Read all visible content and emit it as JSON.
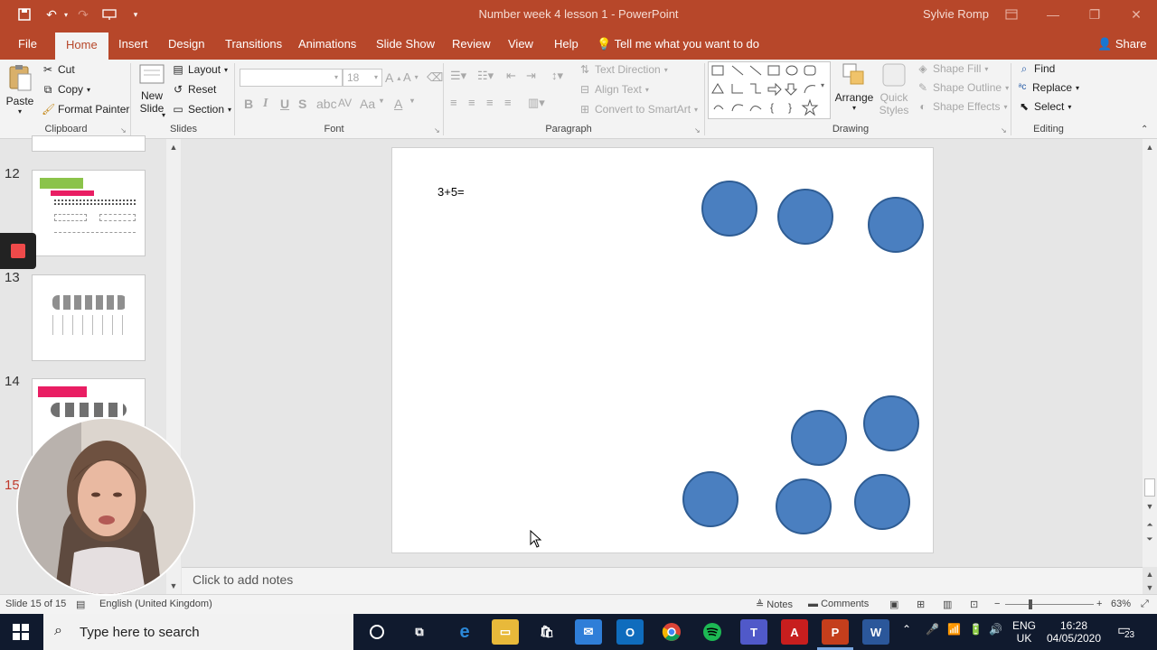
{
  "window": {
    "title": "Number week 4 lesson 1  -  PowerPoint",
    "user": "Sylvie Romp"
  },
  "tabs": [
    {
      "label": "File"
    },
    {
      "label": "Home"
    },
    {
      "label": "Insert"
    },
    {
      "label": "Design"
    },
    {
      "label": "Transitions"
    },
    {
      "label": "Animations"
    },
    {
      "label": "Slide Show"
    },
    {
      "label": "Review"
    },
    {
      "label": "View"
    },
    {
      "label": "Help"
    }
  ],
  "tell_me": "Tell me what you want to do",
  "share": "Share",
  "ribbon": {
    "clipboard": {
      "paste": "Paste",
      "cut": "Cut",
      "copy": "Copy",
      "format_painter": "Format Painter",
      "label": "Clipboard"
    },
    "slides": {
      "new_slide_1": "New",
      "new_slide_2": "Slide",
      "layout": "Layout",
      "reset": "Reset",
      "section": "Section",
      "label": "Slides"
    },
    "font": {
      "size": "18",
      "label": "Font",
      "bold": "B",
      "italic": "I",
      "underline": "U",
      "strike": "S",
      "case": "Aa"
    },
    "paragraph": {
      "text_direction": "Text Direction",
      "align_text": "Align Text",
      "convert_smartart": "Convert to SmartArt",
      "label": "Paragraph"
    },
    "drawing": {
      "arrange": "Arrange",
      "quick_styles_1": "Quick",
      "quick_styles_2": "Styles",
      "shape_fill": "Shape Fill",
      "shape_outline": "Shape Outline",
      "shape_effects": "Shape Effects",
      "label": "Drawing"
    },
    "editing": {
      "find": "Find",
      "replace": "Replace",
      "select": "Select",
      "label": "Editing"
    }
  },
  "thumbnails": {
    "numbers": [
      "12",
      "13",
      "14",
      "15"
    ]
  },
  "slide": {
    "text": "3+5="
  },
  "notes": {
    "placeholder": "Click to add notes"
  },
  "status": {
    "slide_info": "Slide 15 of 15",
    "language": "English (United Kingdom)",
    "notes": "Notes",
    "comments": "Comments",
    "zoom": "63%"
  },
  "taskbar": {
    "search_placeholder": "Type here to search",
    "lang_1": "ENG",
    "lang_2": "UK",
    "time": "16:28",
    "date": "04/05/2020",
    "notifications": "23"
  },
  "colors": {
    "accent": "#b7472a",
    "circle_fill": "#4a7fc0",
    "circle_stroke": "#2f5d94"
  }
}
